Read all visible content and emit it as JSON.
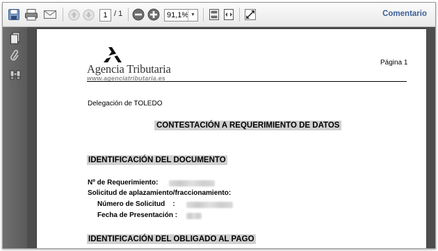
{
  "toolbar": {
    "icons": [
      "save-icon",
      "print-icon",
      "email-icon",
      "previous-page-icon",
      "next-page-icon",
      "zoom-out-icon",
      "zoom-in-icon",
      "fit-page-icon",
      "fit-width-icon",
      "fullscreen-icon"
    ],
    "current_page": "1",
    "page_total": "/ 1",
    "zoom": "91,1%",
    "comment_label": "Comentario"
  },
  "sidebar": {
    "icons": [
      "pages-icon",
      "attachment-icon",
      "search-binoculars-icon"
    ]
  },
  "document": {
    "logo_name": "Agencia Tributaria",
    "logo_url": "www.agenciatributaria.es",
    "page_label": "Página 1",
    "delegacion": "Delegación de TOLEDO",
    "main_title": "CONTESTACIÓN A REQUERIMIENTO DE DATOS",
    "section1_title": "IDENTIFICACIÓN DEL DOCUMENTO",
    "requerimiento_label": "Nº de Requerimiento:",
    "solicitud_label": "Solicitud de aplazamiento/fraccionamiento:",
    "numero_solicitud_label": "Número de Solicitud    :",
    "fecha_label": "Fecha de Presentación :",
    "section2_title": "IDENTIFICACIÓN DEL OBLIGADO AL PAGO"
  },
  "colors": {
    "accent_link": "#3b5f97",
    "section_bg": "#d0d0d0",
    "viewer_bg": "#4d4d4d",
    "sidebar_bg": "#666666"
  }
}
